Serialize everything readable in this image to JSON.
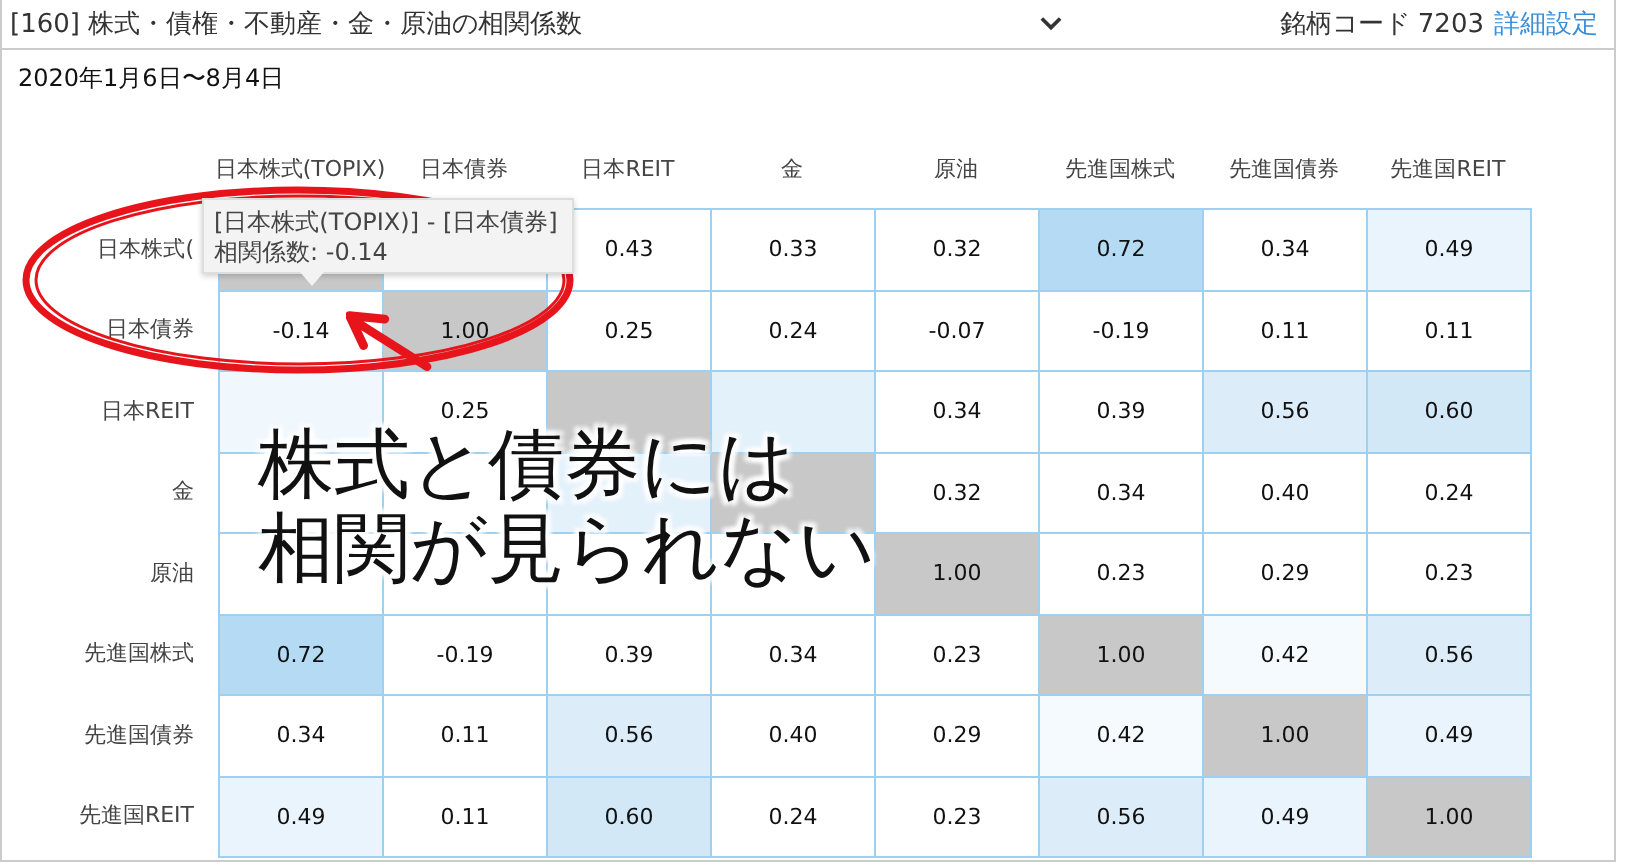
{
  "header": {
    "title": "[160] 株式・債権・不動産・金・原油の相関係数",
    "code_label": "銘柄コード 7203",
    "settings_link": "詳細設定"
  },
  "period": "2020年1月6日〜8月4日",
  "matrix": {
    "columns": [
      "日本株式(TOPIX)",
      "日本債券",
      "日本REIT",
      "金",
      "原油",
      "先進国株式",
      "先進国債券",
      "先進国REIT"
    ],
    "rows": [
      {
        "label": "日本株式(",
        "cells": [
          {
            "color": "#c8c8c8"
          },
          {
            "color": "#ffffff"
          },
          {
            "value": "0.43",
            "color": "#ffffff"
          },
          {
            "value": "0.33",
            "color": "#ffffff"
          },
          {
            "value": "0.32",
            "color": "#ffffff"
          },
          {
            "value": "0.72",
            "color": "#b5daf3"
          },
          {
            "value": "0.34",
            "color": "#ffffff"
          },
          {
            "value": "0.49",
            "color": "#eaf4fc"
          }
        ]
      },
      {
        "label": "日本債券",
        "cells": [
          {
            "value": "-0.14",
            "color": "#ffffff"
          },
          {
            "value": "1.00",
            "color": "#c8c8c8"
          },
          {
            "value": "0.25",
            "color": "#ffffff"
          },
          {
            "value": "0.24",
            "color": "#ffffff"
          },
          {
            "value": "-0.07",
            "color": "#ffffff"
          },
          {
            "value": "-0.19",
            "color": "#ffffff"
          },
          {
            "value": "0.11",
            "color": "#ffffff"
          },
          {
            "value": "0.11",
            "color": "#ffffff"
          }
        ]
      },
      {
        "label": "日本REIT",
        "cells": [
          {
            "color": "#f0f7fd"
          },
          {
            "value": "0.25",
            "color": "#ffffff"
          },
          {
            "color": "#c8c8c8"
          },
          {
            "color": "#e3f1fb"
          },
          {
            "value": "0.34",
            "color": "#ffffff"
          },
          {
            "value": "0.39",
            "color": "#ffffff"
          },
          {
            "value": "0.56",
            "color": "#dcedf9"
          },
          {
            "value": "0.60",
            "color": "#d2e8f7"
          }
        ]
      },
      {
        "label": "金",
        "cells": [
          {
            "color": "#ffffff"
          },
          {
            "color": "#ffffff"
          },
          {
            "color": "#e3f1fb"
          },
          {
            "color": "#c8c8c8"
          },
          {
            "value": "0.32",
            "color": "#ffffff"
          },
          {
            "value": "0.34",
            "color": "#ffffff"
          },
          {
            "value": "0.40",
            "color": "#ffffff"
          },
          {
            "value": "0.24",
            "color": "#ffffff"
          }
        ]
      },
      {
        "label": "原油",
        "cells": [
          {
            "color": "#ffffff"
          },
          {
            "color": "#ffffff"
          },
          {
            "color": "#ffffff"
          },
          {
            "color": "#ffffff"
          },
          {
            "value": "1.00",
            "color": "#c8c8c8"
          },
          {
            "value": "0.23",
            "color": "#ffffff"
          },
          {
            "value": "0.29",
            "color": "#ffffff"
          },
          {
            "value": "0.23",
            "color": "#ffffff"
          }
        ]
      },
      {
        "label": "先進国株式",
        "cells": [
          {
            "value": "0.72",
            "color": "#b5daf3"
          },
          {
            "value": "-0.19",
            "color": "#ffffff"
          },
          {
            "value": "0.39",
            "color": "#ffffff"
          },
          {
            "value": "0.34",
            "color": "#ffffff"
          },
          {
            "value": "0.23",
            "color": "#ffffff"
          },
          {
            "value": "1.00",
            "color": "#c8c8c8"
          },
          {
            "value": "0.42",
            "color": "#f5fafe"
          },
          {
            "value": "0.56",
            "color": "#dcedf9"
          }
        ]
      },
      {
        "label": "先進国債券",
        "cells": [
          {
            "value": "0.34",
            "color": "#ffffff"
          },
          {
            "value": "0.11",
            "color": "#ffffff"
          },
          {
            "value": "0.56",
            "color": "#dcedf9"
          },
          {
            "value": "0.40",
            "color": "#ffffff"
          },
          {
            "value": "0.29",
            "color": "#ffffff"
          },
          {
            "value": "0.42",
            "color": "#f5fafe"
          },
          {
            "value": "1.00",
            "color": "#c8c8c8"
          },
          {
            "value": "0.49",
            "color": "#eaf4fc"
          }
        ]
      },
      {
        "label": "先進国REIT",
        "cells": [
          {
            "value": "0.49",
            "color": "#eaf4fc"
          },
          {
            "value": "0.11",
            "color": "#ffffff"
          },
          {
            "value": "0.60",
            "color": "#d2e8f7"
          },
          {
            "value": "0.24",
            "color": "#ffffff"
          },
          {
            "value": "0.23",
            "color": "#ffffff"
          },
          {
            "value": "0.56",
            "color": "#dcedf9"
          },
          {
            "value": "0.49",
            "color": "#eaf4fc"
          },
          {
            "value": "1.00",
            "color": "#c8c8c8"
          }
        ]
      }
    ]
  },
  "tooltip": {
    "lines": [
      "[日本株式(TOPIX)] - [日本債券]",
      "相関係数: -0.14"
    ]
  },
  "annotation": {
    "lines": [
      "株式と債券には",
      "相関が見られない"
    ]
  }
}
